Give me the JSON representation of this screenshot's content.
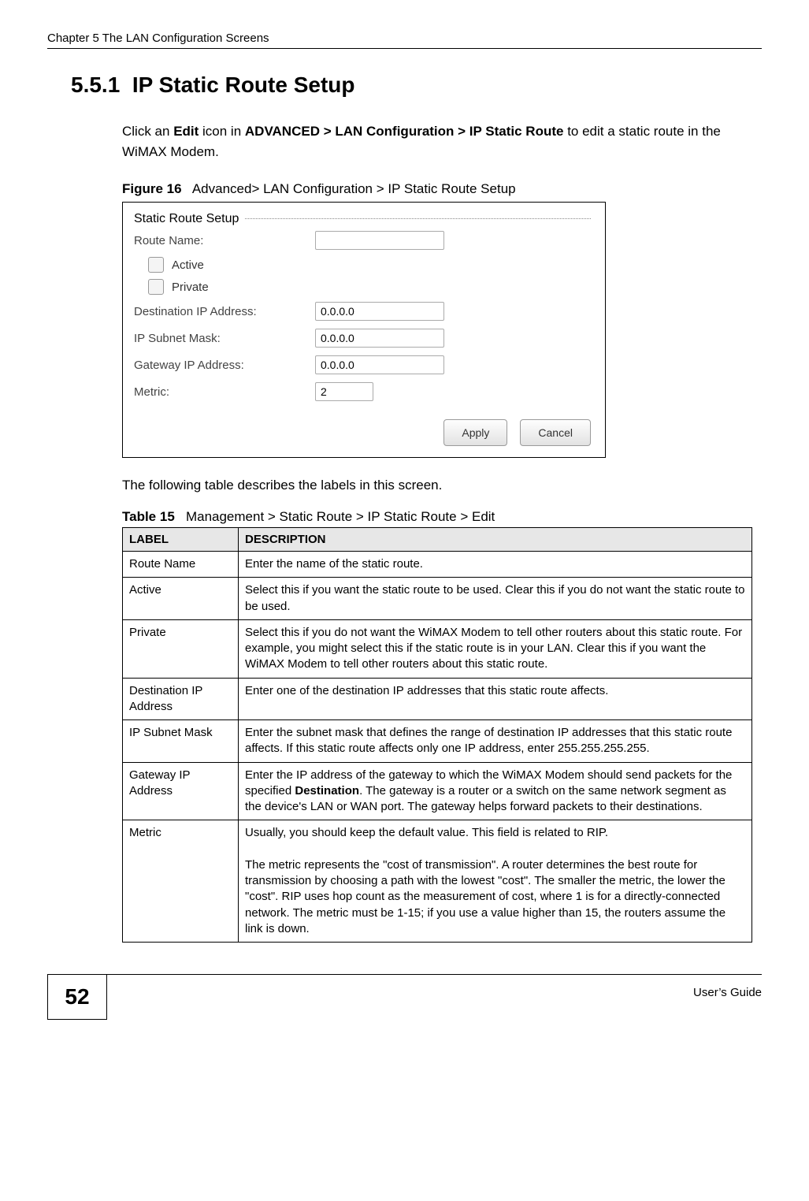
{
  "running_header": "Chapter 5 The LAN Configuration Screens",
  "section_number": "5.5.1",
  "section_title": "IP Static Route Setup",
  "intro_plain_1": "Click an ",
  "intro_bold_1": "Edit",
  "intro_plain_2": " icon in ",
  "intro_bold_2": "ADVANCED > LAN Configuration > IP Static Route",
  "intro_plain_3": " to edit a static route in the WiMAX Modem.",
  "figure_label": "Figure 16",
  "figure_caption": "Advanced> LAN Configuration > IP Static Route Setup",
  "screenshot": {
    "panel_title": "Static Route Setup",
    "route_name_label": "Route Name:",
    "route_name_value": "",
    "active_label": "Active",
    "private_label": "Private",
    "dest_ip_label": "Destination IP Address:",
    "dest_ip_value": "0.0.0.0",
    "subnet_label": "IP Subnet Mask:",
    "subnet_value": "0.0.0.0",
    "gw_label": "Gateway IP Address:",
    "gw_value": "0.0.0.0",
    "metric_label": "Metric:",
    "metric_value": "2",
    "apply_label": "Apply",
    "cancel_label": "Cancel"
  },
  "after_figure_text": "The following table describes the labels in this screen.",
  "table_label": "Table 15",
  "table_caption": "Management > Static Route > IP Static Route > Edit",
  "table_headers": {
    "c1": "LABEL",
    "c2": "DESCRIPTION"
  },
  "table_rows": [
    {
      "label": "Route Name",
      "desc": "Enter the name of the static route."
    },
    {
      "label": "Active",
      "desc": "Select this if you want the static route to be used. Clear this if you do not want the static route to be used."
    },
    {
      "label": "Private",
      "desc": "Select this if you do not want the WiMAX Modem to tell other routers about this static route. For example, you might select this if the static route is in your LAN. Clear this if you want the WiMAX Modem to tell other routers about this static route."
    },
    {
      "label": "Destination IP Address",
      "desc": "Enter one of the destination IP addresses that this static route affects."
    },
    {
      "label": "IP Subnet Mask",
      "desc": "Enter the subnet mask that defines the range of destination IP addresses that this static route affects. If this static route affects only one IP address, enter 255.255.255.255."
    },
    {
      "label": "Gateway IP Address",
      "desc_pre": "Enter the IP address of the gateway to which the WiMAX Modem should send packets for the specified ",
      "desc_bold": "Destination",
      "desc_post": ". The gateway is a router or a switch on the same network segment as the device's LAN or WAN port. The gateway helps forward packets to their destinations."
    },
    {
      "label": "Metric",
      "desc": "Usually, you should keep the default value. This field is related to RIP.\n\nThe metric represents the \"cost of transmission\". A router determines the best route for transmission by choosing a path with the lowest \"cost\". The smaller the metric, the lower the \"cost\". RIP uses hop count as the measurement of cost, where 1 is for a directly-connected network. The metric must be 1-15; if you use a value higher than 15, the routers assume the link is down."
    }
  ],
  "page_number": "52",
  "users_guide": "User’s Guide"
}
